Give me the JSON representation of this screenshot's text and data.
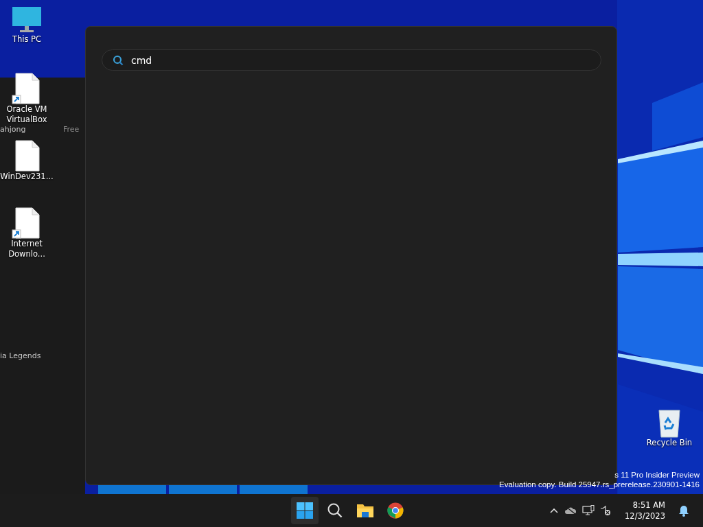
{
  "desktop_icons": [
    {
      "label": "This PC",
      "kind": "computer",
      "shortcut": false
    },
    {
      "label": "Oracle VM VirtualBox",
      "kind": "file",
      "shortcut": true
    },
    {
      "label": "WinDev231...",
      "kind": "file",
      "shortcut": false
    },
    {
      "label": "Internet Downlo...",
      "kind": "file",
      "shortcut": true
    }
  ],
  "background_window": {
    "texts": [
      "ahjong",
      "Free",
      "ia Legends"
    ]
  },
  "recycle_bin": {
    "label": "Recycle Bin"
  },
  "search_panel": {
    "search": {
      "value": "cmd"
    }
  },
  "watermark": [
    "s 11 Pro Insider Preview",
    "Evaluation copy. Build 25947.rs_prerelease.230901-1416"
  ],
  "taskbar": {
    "apps": [
      {
        "kind": "start",
        "selected": true
      },
      {
        "kind": "search",
        "selected": false
      },
      {
        "kind": "explorer",
        "selected": false
      },
      {
        "kind": "chrome",
        "selected": false
      }
    ],
    "tray": [
      {
        "kind": "chevron"
      },
      {
        "kind": "cloud"
      },
      {
        "kind": "network"
      },
      {
        "kind": "volume"
      }
    ],
    "clock": {
      "time": "8:51 AM",
      "date": "12/3/2023"
    }
  }
}
